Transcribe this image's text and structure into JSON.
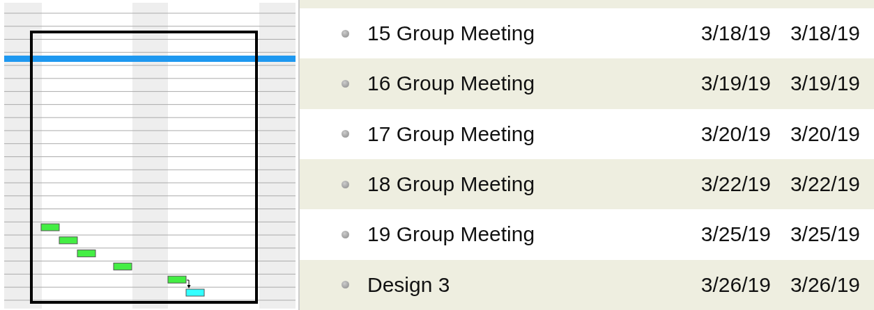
{
  "tasks": [
    {
      "name": "15 Group Meeting",
      "start": "3/18/19",
      "finish": "3/18/19",
      "kind": "meeting"
    },
    {
      "name": "16 Group Meeting",
      "start": "3/19/19",
      "finish": "3/19/19",
      "kind": "meeting"
    },
    {
      "name": "17 Group Meeting",
      "start": "3/20/19",
      "finish": "3/20/19",
      "kind": "meeting"
    },
    {
      "name": "18 Group Meeting",
      "start": "3/22/19",
      "finish": "3/22/19",
      "kind": "meeting"
    },
    {
      "name": "19 Group Meeting",
      "start": "3/25/19",
      "finish": "3/25/19",
      "kind": "meeting"
    },
    {
      "name": "Design 3",
      "start": "3/26/19",
      "finish": "3/26/19",
      "kind": "design"
    }
  ]
}
